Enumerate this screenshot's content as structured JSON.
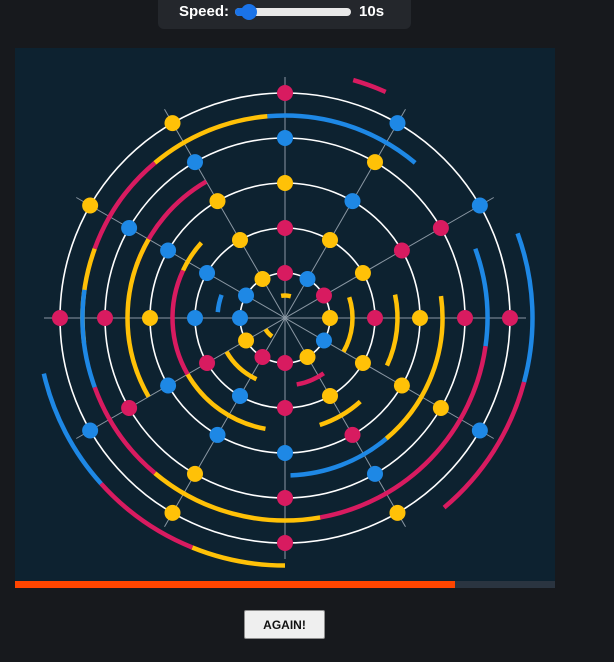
{
  "speed": {
    "label": "Speed:",
    "value_text": "10s",
    "slider": {
      "min": 0,
      "max": 100,
      "value": 12
    }
  },
  "board": {
    "colors": {
      "background": "#0d2230",
      "ring": "#ffffff",
      "spoke": "#8a97a3",
      "magenta": "#d81b60",
      "blue": "#1e88e5",
      "yellow": "#ffc107"
    },
    "rings": [
      1,
      2,
      3,
      4,
      5
    ],
    "spokes": 12,
    "dots": [
      {
        "ring": 5,
        "angle": 0,
        "color": "magenta"
      },
      {
        "ring": 5,
        "angle": 30,
        "color": "blue"
      },
      {
        "ring": 5,
        "angle": 60,
        "color": "blue"
      },
      {
        "ring": 5,
        "angle": 90,
        "color": "magenta"
      },
      {
        "ring": 5,
        "angle": 120,
        "color": "yellow"
      },
      {
        "ring": 5,
        "angle": 150,
        "color": "yellow"
      },
      {
        "ring": 5,
        "angle": 180,
        "color": "magenta"
      },
      {
        "ring": 5,
        "angle": 210,
        "color": "blue"
      },
      {
        "ring": 5,
        "angle": 240,
        "color": "yellow"
      },
      {
        "ring": 5,
        "angle": 270,
        "color": "magenta"
      },
      {
        "ring": 5,
        "angle": 300,
        "color": "yellow"
      },
      {
        "ring": 5,
        "angle": 330,
        "color": "blue"
      },
      {
        "ring": 4,
        "angle": 0,
        "color": "magenta"
      },
      {
        "ring": 4,
        "angle": 30,
        "color": "magenta"
      },
      {
        "ring": 4,
        "angle": 60,
        "color": "yellow"
      },
      {
        "ring": 4,
        "angle": 90,
        "color": "blue"
      },
      {
        "ring": 4,
        "angle": 120,
        "color": "blue"
      },
      {
        "ring": 4,
        "angle": 150,
        "color": "blue"
      },
      {
        "ring": 4,
        "angle": 180,
        "color": "magenta"
      },
      {
        "ring": 4,
        "angle": 210,
        "color": "magenta"
      },
      {
        "ring": 4,
        "angle": 240,
        "color": "yellow"
      },
      {
        "ring": 4,
        "angle": 270,
        "color": "magenta"
      },
      {
        "ring": 4,
        "angle": 300,
        "color": "blue"
      },
      {
        "ring": 4,
        "angle": 330,
        "color": "yellow"
      },
      {
        "ring": 3,
        "angle": 0,
        "color": "yellow"
      },
      {
        "ring": 3,
        "angle": 30,
        "color": "magenta"
      },
      {
        "ring": 3,
        "angle": 60,
        "color": "blue"
      },
      {
        "ring": 3,
        "angle": 90,
        "color": "yellow"
      },
      {
        "ring": 3,
        "angle": 120,
        "color": "yellow"
      },
      {
        "ring": 3,
        "angle": 150,
        "color": "blue"
      },
      {
        "ring": 3,
        "angle": 180,
        "color": "yellow"
      },
      {
        "ring": 3,
        "angle": 210,
        "color": "blue"
      },
      {
        "ring": 3,
        "angle": 240,
        "color": "blue"
      },
      {
        "ring": 3,
        "angle": 270,
        "color": "blue"
      },
      {
        "ring": 3,
        "angle": 300,
        "color": "magenta"
      },
      {
        "ring": 3,
        "angle": 330,
        "color": "yellow"
      },
      {
        "ring": 2,
        "angle": 0,
        "color": "magenta"
      },
      {
        "ring": 2,
        "angle": 30,
        "color": "yellow"
      },
      {
        "ring": 2,
        "angle": 60,
        "color": "yellow"
      },
      {
        "ring": 2,
        "angle": 90,
        "color": "magenta"
      },
      {
        "ring": 2,
        "angle": 120,
        "color": "yellow"
      },
      {
        "ring": 2,
        "angle": 150,
        "color": "blue"
      },
      {
        "ring": 2,
        "angle": 180,
        "color": "blue"
      },
      {
        "ring": 2,
        "angle": 210,
        "color": "magenta"
      },
      {
        "ring": 2,
        "angle": 240,
        "color": "blue"
      },
      {
        "ring": 2,
        "angle": 270,
        "color": "magenta"
      },
      {
        "ring": 2,
        "angle": 300,
        "color": "yellow"
      },
      {
        "ring": 2,
        "angle": 330,
        "color": "yellow"
      },
      {
        "ring": 1,
        "angle": 0,
        "color": "yellow"
      },
      {
        "ring": 1,
        "angle": 30,
        "color": "magenta"
      },
      {
        "ring": 1,
        "angle": 60,
        "color": "blue"
      },
      {
        "ring": 1,
        "angle": 90,
        "color": "magenta"
      },
      {
        "ring": 1,
        "angle": 120,
        "color": "yellow"
      },
      {
        "ring": 1,
        "angle": 150,
        "color": "blue"
      },
      {
        "ring": 1,
        "angle": 180,
        "color": "blue"
      },
      {
        "ring": 1,
        "angle": 210,
        "color": "yellow"
      },
      {
        "ring": 1,
        "angle": 240,
        "color": "magenta"
      },
      {
        "ring": 1,
        "angle": 270,
        "color": "magenta"
      },
      {
        "ring": 1,
        "angle": 300,
        "color": "yellow"
      },
      {
        "ring": 1,
        "angle": 330,
        "color": "blue"
      }
    ],
    "arcs": [
      {
        "ring": 6,
        "start": 20,
        "end": -15,
        "color": "blue"
      },
      {
        "ring": 6,
        "start": -15,
        "end": -50,
        "color": "magenta"
      },
      {
        "ring": 6,
        "start": 248,
        "end": 270,
        "color": "yellow"
      },
      {
        "ring": 6,
        "start": 222,
        "end": 248,
        "color": "magenta"
      },
      {
        "ring": 6,
        "start": 193,
        "end": 222,
        "color": "blue"
      },
      {
        "ring": 6,
        "start": 66,
        "end": 74,
        "color": "magenta"
      },
      {
        "ring": 5,
        "start": 20,
        "end": -8,
        "color": "blue"
      },
      {
        "ring": 5,
        "start": 50,
        "end": 95,
        "color": "blue"
      },
      {
        "ring": 5,
        "start": 95,
        "end": 130,
        "color": "yellow"
      },
      {
        "ring": 5,
        "start": 130,
        "end": 160,
        "color": "magenta"
      },
      {
        "ring": 5,
        "start": 160,
        "end": 187,
        "color": "yellow"
      },
      {
        "ring": 5,
        "start": -8,
        "end": -80,
        "color": "magenta"
      },
      {
        "ring": 5,
        "start": -80,
        "end": -130,
        "color": "yellow"
      },
      {
        "ring": 5,
        "start": -130,
        "end": -160,
        "color": "magenta"
      },
      {
        "ring": 5,
        "start": -160,
        "end": -188,
        "color": "blue"
      },
      {
        "ring": 4,
        "start": 8,
        "end": -50,
        "color": "yellow"
      },
      {
        "ring": 4,
        "start": -50,
        "end": -88,
        "color": "blue"
      },
      {
        "ring": 4,
        "start": -200,
        "end": -240,
        "color": "magenta"
      },
      {
        "ring": 4,
        "start": -150,
        "end": -210,
        "color": "yellow"
      },
      {
        "ring": 3,
        "start": 12,
        "end": -25,
        "color": "yellow"
      },
      {
        "ring": 3,
        "start": -48,
        "end": -72,
        "color": "yellow"
      },
      {
        "ring": 3,
        "start": -100,
        "end": -150,
        "color": "yellow"
      },
      {
        "ring": 3,
        "start": -150,
        "end": -205,
        "color": "magenta"
      },
      {
        "ring": 3,
        "start": -205,
        "end": -222,
        "color": "yellow"
      },
      {
        "ring": 2,
        "start": 18,
        "end": -30,
        "color": "yellow"
      },
      {
        "ring": 2,
        "start": -55,
        "end": -80,
        "color": "magenta"
      },
      {
        "ring": 2,
        "start": -115,
        "end": -150,
        "color": "yellow"
      },
      {
        "ring": 2,
        "start": -185,
        "end": -200,
        "color": "blue"
      },
      {
        "ring": 1,
        "start": -125,
        "end": -150,
        "color": "yellow"
      },
      {
        "ring": 1,
        "start": -260,
        "end": -285,
        "color": "yellow"
      }
    ]
  },
  "progress": {
    "fraction": 0.815
  },
  "again_button": {
    "label": "AGAIN!"
  }
}
